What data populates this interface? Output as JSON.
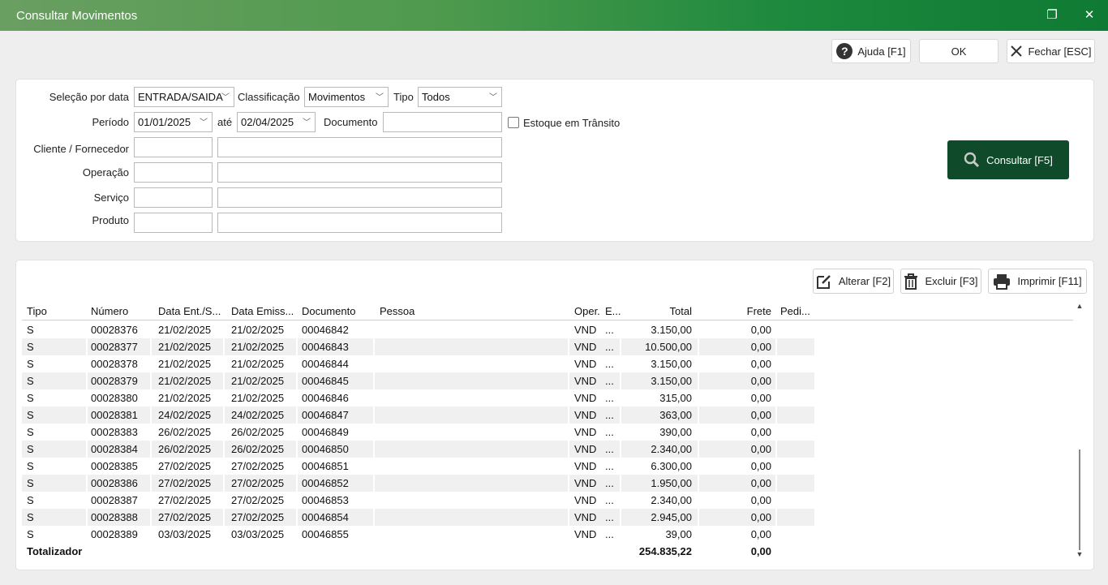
{
  "window": {
    "title": "Consultar Movimentos",
    "restore_glyph": "❐",
    "close_glyph": "✕"
  },
  "toolbar": {
    "help_label": "Ajuda [F1]",
    "ok_label": "OK",
    "close_label": "Fechar [ESC]"
  },
  "filters": {
    "selecao_label": "Seleção por data",
    "selecao_value": "ENTRADA/SAIDA",
    "classificacao_label": "Classificação",
    "classificacao_value": "Movimentos",
    "tipo_label": "Tipo",
    "tipo_value": "Todos",
    "periodo_label": "Período",
    "periodo_from": "01/01/2025",
    "ate_label": "até",
    "periodo_to": "02/04/2025",
    "documento_label": "Documento",
    "documento_value": "",
    "estoque_label": "Estoque em Trânsito",
    "cliente_label": "Cliente / Fornecedor",
    "operacao_label": "Operação",
    "servico_label": "Serviço",
    "produto_label": "Produto"
  },
  "consultar_label": "Consultar [F5]",
  "actions": {
    "alterar_label": "Alterar [F2]",
    "excluir_label": "Excluir [F3]",
    "imprimir_label": "Imprimir [F11]"
  },
  "grid": {
    "columns": [
      "Tipo",
      "Número",
      "Data Ent./S...",
      "Data Emiss...",
      "Documento",
      "Pessoa",
      "Oper.",
      "E...",
      "Total",
      "Frete",
      "Pedi..."
    ],
    "rows": [
      [
        "S",
        "00028376",
        "21/02/2025",
        "21/02/2025",
        "00046842",
        "",
        "VND",
        "...",
        "3.150,00",
        "0,00",
        ""
      ],
      [
        "S",
        "00028377",
        "21/02/2025",
        "21/02/2025",
        "00046843",
        "",
        "VND",
        "...",
        "10.500,00",
        "0,00",
        ""
      ],
      [
        "S",
        "00028378",
        "21/02/2025",
        "21/02/2025",
        "00046844",
        "",
        "VND",
        "...",
        "3.150,00",
        "0,00",
        ""
      ],
      [
        "S",
        "00028379",
        "21/02/2025",
        "21/02/2025",
        "00046845",
        "",
        "VND",
        "...",
        "3.150,00",
        "0,00",
        ""
      ],
      [
        "S",
        "00028380",
        "21/02/2025",
        "21/02/2025",
        "00046846",
        "",
        "VND",
        "...",
        "315,00",
        "0,00",
        ""
      ],
      [
        "S",
        "00028381",
        "24/02/2025",
        "24/02/2025",
        "00046847",
        "",
        "VND",
        "...",
        "363,00",
        "0,00",
        ""
      ],
      [
        "S",
        "00028383",
        "26/02/2025",
        "26/02/2025",
        "00046849",
        "",
        "VND",
        "...",
        "390,00",
        "0,00",
        ""
      ],
      [
        "S",
        "00028384",
        "26/02/2025",
        "26/02/2025",
        "00046850",
        "",
        "VND",
        "...",
        "2.340,00",
        "0,00",
        ""
      ],
      [
        "S",
        "00028385",
        "27/02/2025",
        "27/02/2025",
        "00046851",
        "",
        "VND",
        "...",
        "6.300,00",
        "0,00",
        ""
      ],
      [
        "S",
        "00028386",
        "27/02/2025",
        "27/02/2025",
        "00046852",
        "",
        "VND",
        "...",
        "1.950,00",
        "0,00",
        ""
      ],
      [
        "S",
        "00028387",
        "27/02/2025",
        "27/02/2025",
        "00046853",
        "",
        "VND",
        "...",
        "2.340,00",
        "0,00",
        ""
      ],
      [
        "S",
        "00028388",
        "27/02/2025",
        "27/02/2025",
        "00046854",
        "",
        "VND",
        "...",
        "2.945,00",
        "0,00",
        ""
      ],
      [
        "S",
        "00028389",
        "03/03/2025",
        "03/03/2025",
        "00046855",
        "",
        "VND",
        "...",
        "39,00",
        "0,00",
        ""
      ]
    ],
    "total_row": [
      "Totalizador",
      "",
      "",
      "",
      "",
      "",
      "",
      "",
      "254.835,22",
      "0,00",
      ""
    ]
  },
  "colors": {
    "title_bar": "#1e8a3e",
    "consultar_bg": "#0f4a2a"
  }
}
